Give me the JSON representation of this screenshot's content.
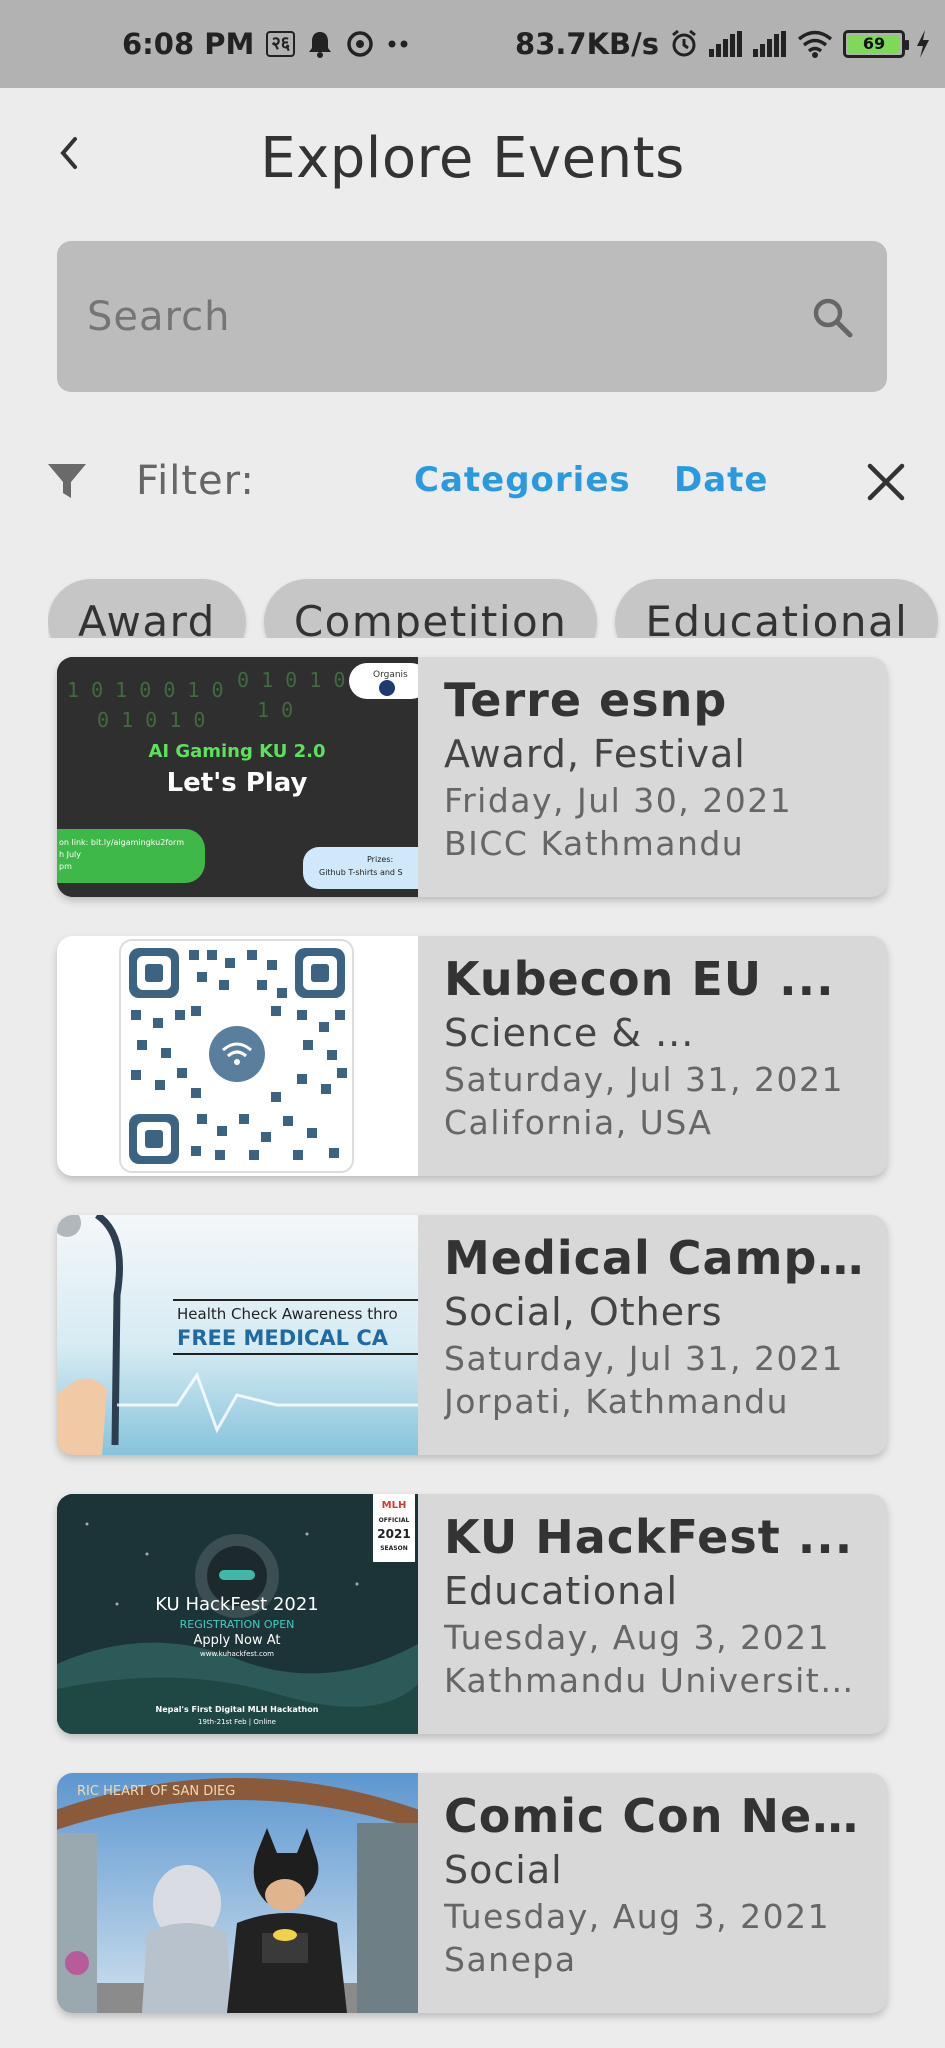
{
  "status_bar": {
    "time": "6:08 PM",
    "badge": "२६",
    "network_speed": "83.7KB/s",
    "battery": "69"
  },
  "header": {
    "title": "Explore Events"
  },
  "search": {
    "placeholder": "Search"
  },
  "filter": {
    "label": "Filter:",
    "categories_label": "Categories",
    "date_label": "Date"
  },
  "chips": [
    "Award",
    "Competition",
    "Educational"
  ],
  "events": [
    {
      "title": "Terre esnp",
      "categories": "Award, Festival",
      "date": "Friday, Jul 30, 2021",
      "location": "BICC Kathmandu",
      "thumb": {
        "headline": "AI Gaming KU 2.0",
        "sub": "Let's Play",
        "left_note": "on link: bit.ly/aigamingku2form",
        "left_note2": "h July",
        "left_note3": "pm",
        "prize_title": "Prizes:",
        "prize_text": "Github T-shirts and S",
        "org": "Organis"
      }
    },
    {
      "title": "Kubecon EU ...",
      "categories": "Science & ...",
      "date": "Saturday, Jul 31, 2021",
      "location": "California, USA"
    },
    {
      "title": "Medical Camp ...",
      "categories": "Social, Others",
      "date": "Saturday, Jul 31, 2021",
      "location": "Jorpati, Kathmandu",
      "thumb": {
        "line1": "Health Check Awareness thro",
        "line2": "FREE MEDICAL CA"
      }
    },
    {
      "title": "KU HackFest ...",
      "categories": "Educational",
      "date": "Tuesday, Aug 3, 2021",
      "location": "Kathmandu University...",
      "thumb": {
        "badge_top": "MLH",
        "badge_mid": "OFFICIAL",
        "badge_year": "2021",
        "badge_bottom": "SEASON",
        "headline": "KU HackFest 2021",
        "line1": "REGISTRATION OPEN",
        "line2": "Apply Now At",
        "url": "www.kuhackfest.com",
        "footer1": "Nepal's First Digital MLH Hackathon",
        "footer2": "19th-21st Feb | Online"
      }
    },
    {
      "title": "Comic Con Nepal",
      "categories": "Social",
      "date": "Tuesday, Aug 3, 2021",
      "location": "Sanepa",
      "thumb": {
        "arch_text": "RIC HEART OF SAN DIEG"
      }
    }
  ]
}
